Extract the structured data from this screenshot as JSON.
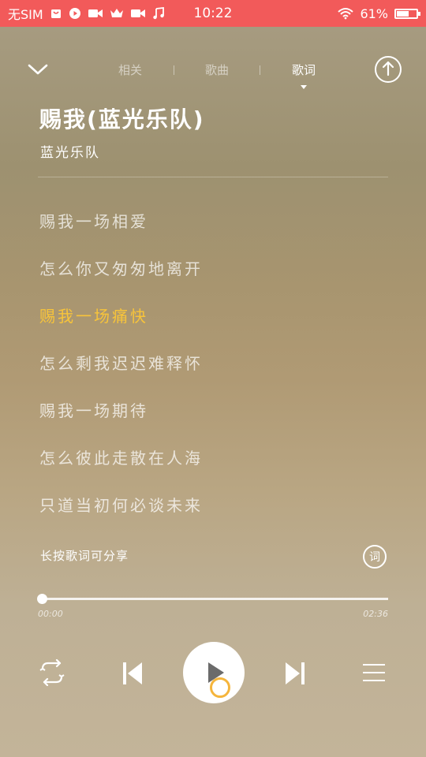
{
  "status": {
    "carrier": "无SIM",
    "time": "10:22",
    "battery": "61%",
    "battery_level": 0.61
  },
  "nav": {
    "tabs": [
      "相关",
      "歌曲",
      "歌词"
    ],
    "active_tab": 2
  },
  "song": {
    "title": "赐我(蓝光乐队)",
    "artist": "蓝光乐队"
  },
  "lyrics": [
    {
      "text": "赐我一场相爱",
      "current": false
    },
    {
      "text": "怎么你又匆匆地离开",
      "current": false
    },
    {
      "text": "赐我一场痛快",
      "current": true
    },
    {
      "text": "怎么剩我迟迟难释怀",
      "current": false
    },
    {
      "text": "赐我一场期待",
      "current": false
    },
    {
      "text": "怎么彼此走散在人海",
      "current": false
    },
    {
      "text": "只道当初何必谈未来",
      "current": false
    }
  ],
  "share_hint": "长按歌词可分享",
  "lyrics_button": "词",
  "player": {
    "current_time": "00:00",
    "total_time": "02:36",
    "progress": 0.0
  },
  "icons": {
    "back": "chevron-down-icon",
    "share": "upload-icon",
    "mode": "repeat-icon",
    "prev": "skip-previous-icon",
    "play": "play-icon",
    "next": "skip-next-icon",
    "playlist": "playlist-icon"
  },
  "colors": {
    "status_bar": "#f25a5a",
    "current_lyric": "#f8c43a"
  }
}
